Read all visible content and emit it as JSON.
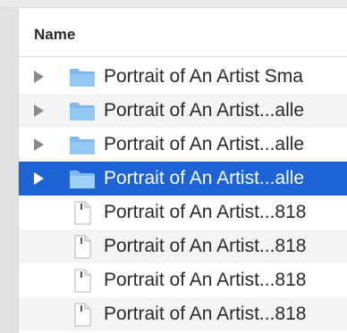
{
  "header": {
    "name_column": "Name"
  },
  "colors": {
    "selection": "#1d63d6",
    "folder": "#8cc2f0",
    "alt_row": "#f4f4f4"
  },
  "rows": [
    {
      "label": "Portrait of An Artist Sma",
      "kind": "folder",
      "icon": "folder-icon",
      "selected": false
    },
    {
      "label": "Portrait of An Artist...alle",
      "kind": "folder",
      "icon": "folder-icon",
      "selected": false
    },
    {
      "label": "Portrait of An Artist...alle",
      "kind": "folder",
      "icon": "folder-icon",
      "selected": false
    },
    {
      "label": "Portrait of An Artist...alle",
      "kind": "folder",
      "icon": "folder-icon",
      "selected": true
    },
    {
      "label": "Portrait of An Artist...818",
      "kind": "file",
      "icon": "document-icon",
      "selected": false
    },
    {
      "label": "Portrait of An Artist...818",
      "kind": "file",
      "icon": "document-icon",
      "selected": false
    },
    {
      "label": "Portrait of An Artist...818",
      "kind": "file",
      "icon": "document-icon",
      "selected": false
    },
    {
      "label": "Portrait of An Artist...818",
      "kind": "file",
      "icon": "document-icon",
      "selected": false
    }
  ]
}
